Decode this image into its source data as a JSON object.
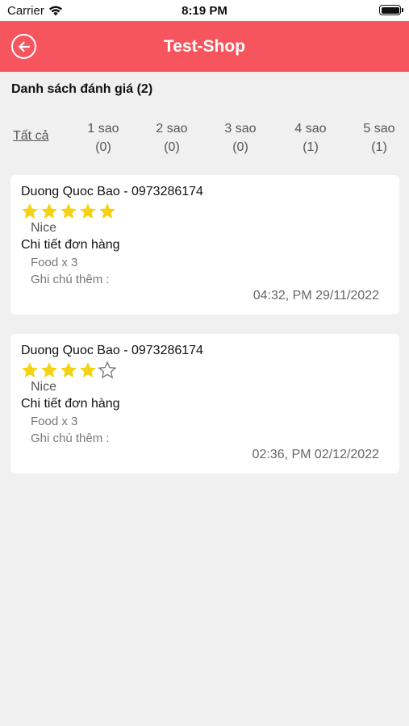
{
  "status_bar": {
    "carrier": "Carrier",
    "time": "8:19 PM"
  },
  "header": {
    "title": "Test-Shop",
    "back_icon": "back-arrow-circle-icon"
  },
  "review_count_label": "Danh sách đánh giá (2)",
  "filters": {
    "all_label": "Tất cả",
    "items": [
      {
        "label": "1 sao",
        "count": "(0)"
      },
      {
        "label": "2 sao",
        "count": "(0)"
      },
      {
        "label": "3 sao",
        "count": "(0)"
      },
      {
        "label": "4 sao",
        "count": "(1)"
      },
      {
        "label": "5 sao",
        "count": "(1)"
      }
    ]
  },
  "reviews": [
    {
      "name": "Duong Quoc Bao - 0973286174",
      "rating": 5,
      "max_rating": 5,
      "comment": "Nice",
      "detail_label": "Chi tiết đơn hàng",
      "item_line": "Food x 3",
      "note": "Ghi chú thêm :",
      "datetime": "04:32, PM 29/11/2022"
    },
    {
      "name": "Duong Quoc Bao - 0973286174",
      "rating": 4,
      "max_rating": 5,
      "comment": "Nice",
      "detail_label": "Chi tiết đơn hàng",
      "item_line": "Food x 3",
      "note": "Ghi chú thêm :",
      "datetime": "02:36, PM 02/12/2022"
    }
  ],
  "colors": {
    "header_bg": "#f7555d",
    "star_filled": "#f5d312",
    "star_empty_stroke": "#777777"
  }
}
